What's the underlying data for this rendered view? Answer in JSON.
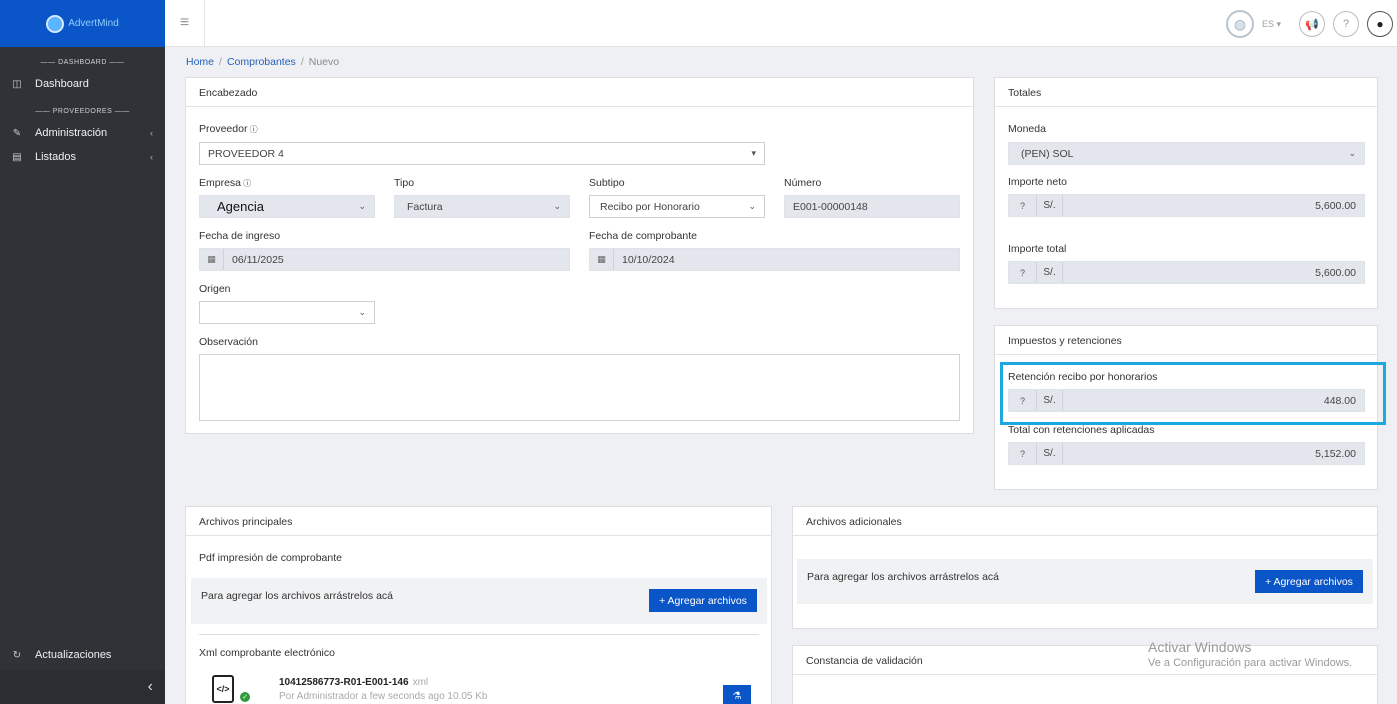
{
  "brand": {
    "name": "AdvertMind",
    "logo_icon": "advertmind-logo-icon"
  },
  "sidebar": {
    "section_dashboard": "DASHBOARD",
    "section_proveedores": "PROVEEDORES",
    "items": [
      {
        "label": "Dashboard",
        "icon": "columns-icon"
      },
      {
        "label": "Administración",
        "icon": "wrench-icon"
      },
      {
        "label": "Listados",
        "icon": "list-icon"
      }
    ],
    "bottom_item": {
      "label": "Actualizaciones",
      "icon": "refresh-icon"
    },
    "collapse_glyph": "‹"
  },
  "topbar": {
    "language": "ES",
    "icons": [
      "globe-icon",
      "megaphone-icon",
      "help-icon",
      "user-icon"
    ]
  },
  "breadcrumb": {
    "home": "Home",
    "section": "Comprobantes",
    "current": "Nuevo"
  },
  "encabezado": {
    "title": "Encabezado",
    "proveedor_label": "Proveedor",
    "proveedor_value": "PROVEEDOR 4",
    "empresa_label": "Empresa",
    "empresa_value": "Agencia",
    "tipo_label": "Tipo",
    "tipo_value": "Factura",
    "subtipo_label": "Subtipo",
    "subtipo_value": "Recibo por Honorario",
    "numero_label": "Número",
    "numero_value": "E001-00000148",
    "fecha_ingreso_label": "Fecha de ingreso",
    "fecha_ingreso_value": "06/11/2025",
    "fecha_comprobante_label": "Fecha de comprobante",
    "fecha_comprobante_value": "10/10/2024",
    "origen_label": "Origen",
    "origen_value": "",
    "observacion_label": "Observación",
    "observacion_value": ""
  },
  "totales": {
    "title": "Totales",
    "moneda_label": "Moneda",
    "moneda_value": "(PEN) SOL",
    "importe_neto_label": "Importe neto",
    "importe_neto_value": "5,600.00",
    "importe_total_label": "Importe total",
    "importe_total_value": "5,600.00",
    "currency_symbol": "S/."
  },
  "impuestos": {
    "title": "Impuestos y retenciones",
    "retencion_label": "Retención recibo por honorarios",
    "retencion_value": "448.00",
    "total_label": "Total con retenciones aplicadas",
    "total_value": "5,152.00",
    "highlight_color": "#1ea8e0"
  },
  "archivos_principales": {
    "title": "Archivos principales",
    "pdf_label": "Pdf impresión de comprobante",
    "drop_text": "Para agregar los archivos arrástrelos acá",
    "add_button": "+ Agregar archivos",
    "xml_label": "Xml comprobante electrónico",
    "file_name": "10412586773-R01-E001-146",
    "file_ext": "xml",
    "file_meta": "Por Administrador  a few seconds ago  10.05 Kb"
  },
  "archivos_adicionales": {
    "title": "Archivos adicionales",
    "drop_text": "Para agregar los archivos arrástrelos acá",
    "add_button": "+ Agregar archivos"
  },
  "constancia": {
    "title": "Constancia de validación"
  },
  "watermark": {
    "line1": "Activar Windows",
    "line2": "Ve a Configuración para activar Windows."
  },
  "colors": {
    "primary": "#0a55c8",
    "sidebar": "#2f3338",
    "input_bg": "#e3e6ec"
  }
}
